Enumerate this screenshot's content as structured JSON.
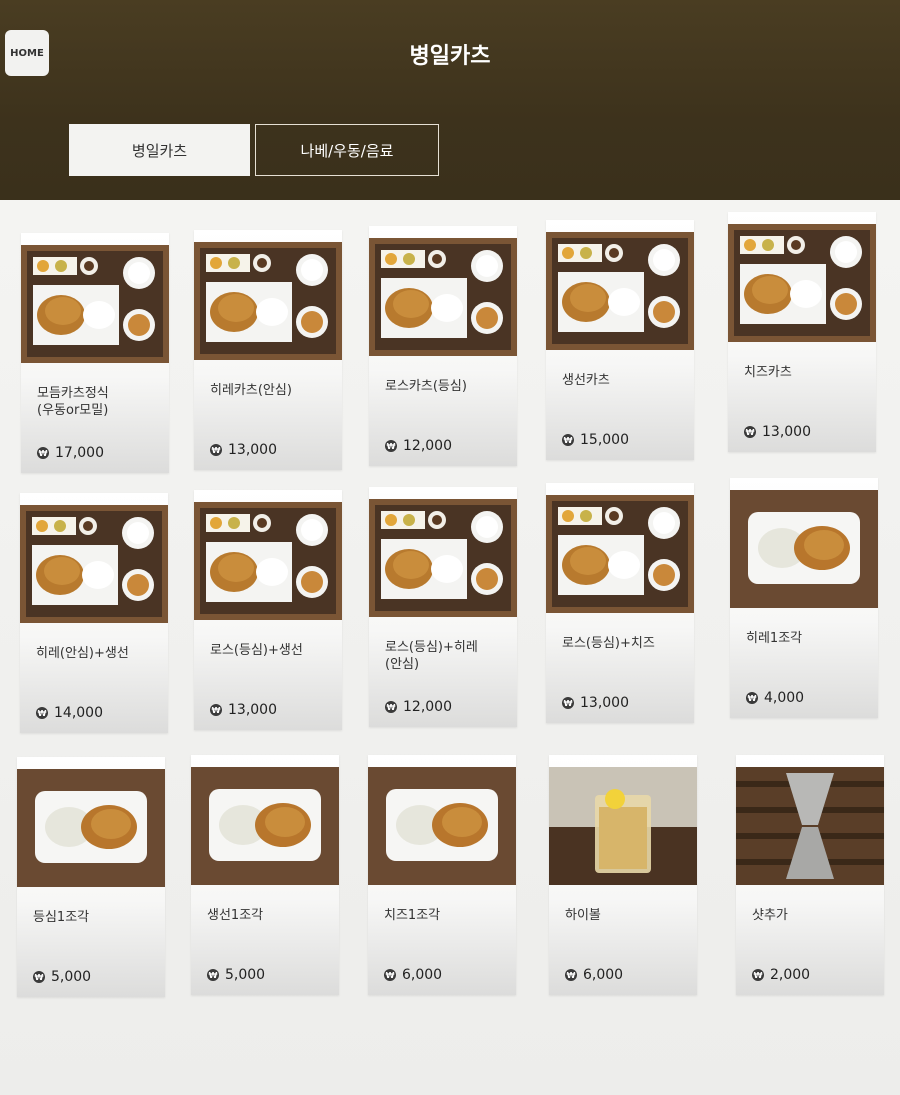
{
  "header": {
    "home_label": "HOME",
    "title": "병일카츠"
  },
  "tabs": [
    {
      "label": "병일카츠",
      "active": true
    },
    {
      "label": "나베/우동/음료",
      "active": false
    }
  ],
  "currency_icon": "won-icon",
  "menu": [
    {
      "name": "모듬카츠정식\n(우동or모밀)",
      "price": "17,000",
      "photo": "set-meal"
    },
    {
      "name": "히레카츠(안심)",
      "price": "13,000",
      "photo": "set-meal"
    },
    {
      "name": "로스카츠(등심)",
      "price": "12,000",
      "photo": "set-meal"
    },
    {
      "name": "생선카츠",
      "price": "15,000",
      "photo": "set-meal"
    },
    {
      "name": "치즈카츠",
      "price": "13,000",
      "photo": "set-meal"
    },
    {
      "name": "히레(안심)+생선",
      "price": "14,000",
      "photo": "set-meal"
    },
    {
      "name": "로스(등심)+생선",
      "price": "13,000",
      "photo": "set-meal"
    },
    {
      "name": "로스(등심)+히레\n(안심)",
      "price": "12,000",
      "photo": "set-meal"
    },
    {
      "name": "로스(등심)+치즈",
      "price": "13,000",
      "photo": "set-meal"
    },
    {
      "name": "히레1조각",
      "price": "4,000",
      "photo": "single-plate"
    },
    {
      "name": "등심1조각",
      "price": "5,000",
      "photo": "single-plate"
    },
    {
      "name": "생선1조각",
      "price": "5,000",
      "photo": "single-plate"
    },
    {
      "name": "치즈1조각",
      "price": "6,000",
      "photo": "single-plate"
    },
    {
      "name": "하이볼",
      "price": "6,000",
      "photo": "highball-glass"
    },
    {
      "name": "샷추가",
      "price": "2,000",
      "photo": "jigger"
    }
  ]
}
